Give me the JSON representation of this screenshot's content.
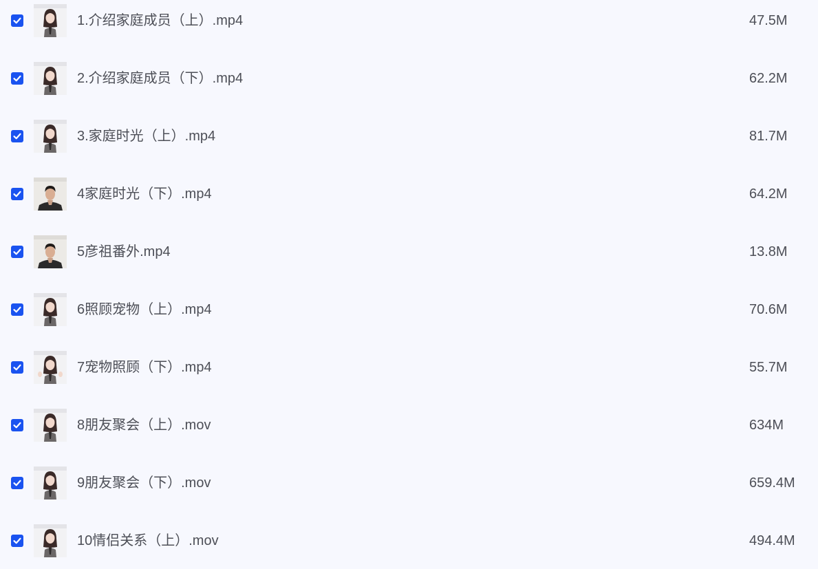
{
  "colors": {
    "background": "#f7f8fe",
    "checkbox": "#1a53f0",
    "text": "#4d4f57"
  },
  "files": [
    {
      "name": "1.介绍家庭成员（上）.mp4",
      "size": "47.5M",
      "checked": true,
      "thumbnail": "woman-presenter"
    },
    {
      "name": "2.介绍家庭成员（下）.mp4",
      "size": "62.2M",
      "checked": true,
      "thumbnail": "woman-presenter"
    },
    {
      "name": "3.家庭时光（上）.mp4",
      "size": "81.7M",
      "checked": true,
      "thumbnail": "woman-presenter"
    },
    {
      "name": "4家庭时光（下）.mp4",
      "size": "64.2M",
      "checked": true,
      "thumbnail": "man-presenter"
    },
    {
      "name": "5彦祖番外.mp4",
      "size": "13.8M",
      "checked": true,
      "thumbnail": "man-presenter"
    },
    {
      "name": "6照顾宠物（上）.mp4",
      "size": "70.6M",
      "checked": true,
      "thumbnail": "woman-presenter"
    },
    {
      "name": "7宠物照顾（下）.mp4",
      "size": "55.7M",
      "checked": true,
      "thumbnail": "woman-presenter"
    },
    {
      "name": "8朋友聚会（上）.mov",
      "size": "634M",
      "checked": true,
      "thumbnail": "woman-presenter"
    },
    {
      "name": "9朋友聚会（下）.mov",
      "size": "659.4M",
      "checked": true,
      "thumbnail": "woman-presenter"
    },
    {
      "name": "10情侣关系（上）.mov",
      "size": "494.4M",
      "checked": true,
      "thumbnail": "woman-presenter"
    }
  ]
}
